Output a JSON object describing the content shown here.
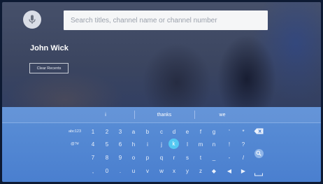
{
  "search": {
    "placeholder": "Search titles, channel name or channel number"
  },
  "recent": {
    "title": "John Wick",
    "clear_label": "Clear Recents"
  },
  "keyboard": {
    "suggestions": [
      "i",
      "thanks",
      "we"
    ],
    "mode_keys": [
      "abc123",
      "@?#"
    ],
    "rows": [
      [
        "1",
        "2",
        "3",
        "a",
        "b",
        "c",
        "d",
        "e",
        "f",
        "g",
        "'",
        "*"
      ],
      [
        "4",
        "5",
        "6",
        "h",
        "i",
        "j",
        "k",
        "l",
        "m",
        "n",
        "!",
        "?"
      ],
      [
        "7",
        "8",
        "9",
        "o",
        "p",
        "q",
        "r",
        "s",
        "t",
        "_",
        "-",
        "/"
      ],
      [
        ",",
        "0",
        ".",
        "u",
        "v",
        "w",
        "x",
        "y",
        "z",
        "◆",
        "◀",
        "▶"
      ]
    ],
    "focused_key": "k",
    "icons": {
      "backspace": "backspace-icon",
      "search": "search-icon",
      "space": "space-icon",
      "mic": "microphone-icon"
    }
  },
  "colors": {
    "keyboard_bg": "#4a7fcf",
    "focus": "#54c8f2"
  }
}
